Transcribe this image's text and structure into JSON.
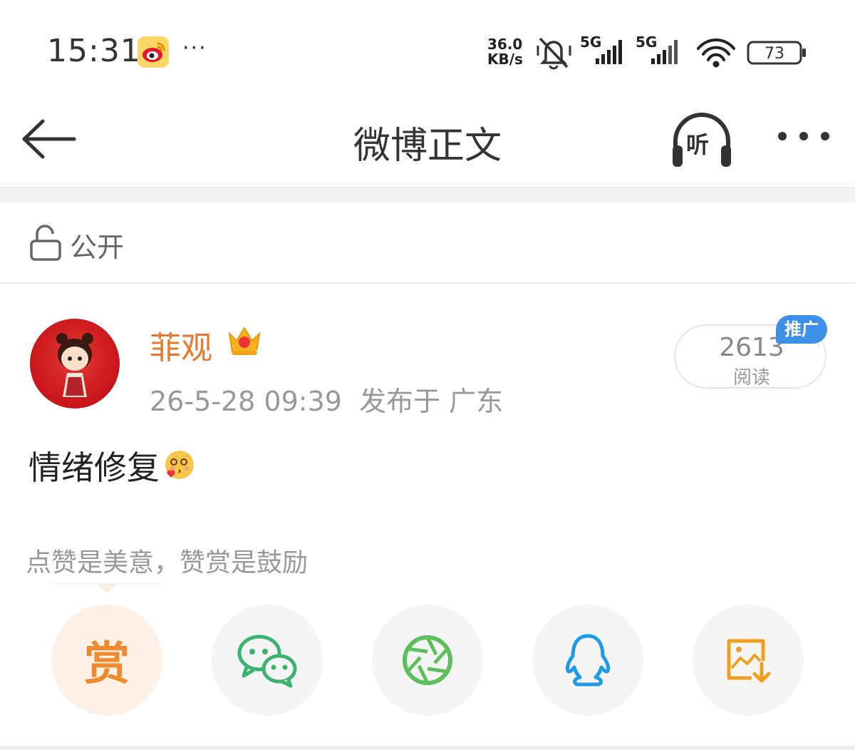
{
  "status_bar": {
    "time": "15:31",
    "more": "···",
    "net_speed_value": "36.0",
    "net_speed_unit": "KB/s",
    "network_1": "5G",
    "network_2": "5G",
    "battery": "73",
    "app_icon": "weibo-icon"
  },
  "header": {
    "title": "微博正文",
    "listen_label": "听",
    "back_icon": "arrow-left-icon",
    "more_icon": "more-dots-icon"
  },
  "visibility": {
    "label": "公开",
    "icon": "unlock-icon"
  },
  "post": {
    "username": "菲观",
    "timestamp": "26-5-28 09:39",
    "location": "发布于 广东",
    "text": "情绪修复",
    "read_count": "2613",
    "read_label": "阅读",
    "promo_tag": "推广"
  },
  "reward": {
    "caption": "点赞是美意，赞赏是鼓励",
    "reward_glyph": "赏"
  },
  "share": {
    "items": [
      {
        "name": "reward",
        "icon": "reward-icon"
      },
      {
        "name": "wechat",
        "icon": "wechat-icon"
      },
      {
        "name": "moments",
        "icon": "moments-icon"
      },
      {
        "name": "qq",
        "icon": "qq-icon"
      },
      {
        "name": "save-image",
        "icon": "save-image-icon"
      }
    ]
  },
  "colors": {
    "username": "#e8782a",
    "promo": "#3d8fe8",
    "reward": "#ef8a2e",
    "wechat": "#3cb371",
    "moments": "#5cc05c",
    "qq": "#1e9be8",
    "save": "#f0a020"
  }
}
